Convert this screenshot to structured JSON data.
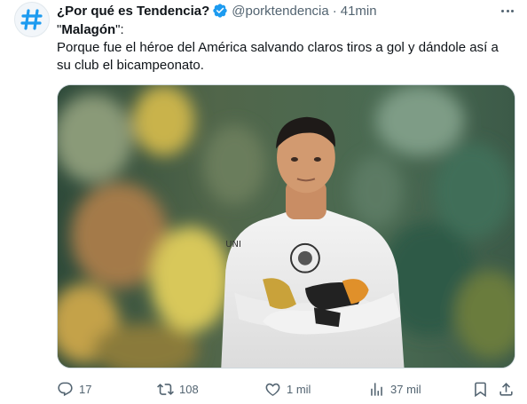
{
  "tweet": {
    "display_name": "¿Por qué es Tendencia?",
    "handle": "@porktendencia",
    "separator": "·",
    "time": "41min",
    "quote_open": "\"",
    "keyword": "Malagón",
    "quote_close": "\":",
    "body": "Porque fue el héroe del América salvando claros tiros a gol y dándole así a su club el bicampeonato."
  },
  "actions": {
    "reply_count": "17",
    "retweet_count": "108",
    "like_count": "1 mil",
    "view_count": "37 mil"
  },
  "colors": {
    "accent": "#1d9bf0",
    "muted": "#536471",
    "text": "#0f1419"
  },
  "icons": [
    "hashtag-icon",
    "verified-badge-icon",
    "more-icon",
    "reply-icon",
    "retweet-icon",
    "like-icon",
    "views-icon",
    "bookmark-icon",
    "share-icon"
  ]
}
